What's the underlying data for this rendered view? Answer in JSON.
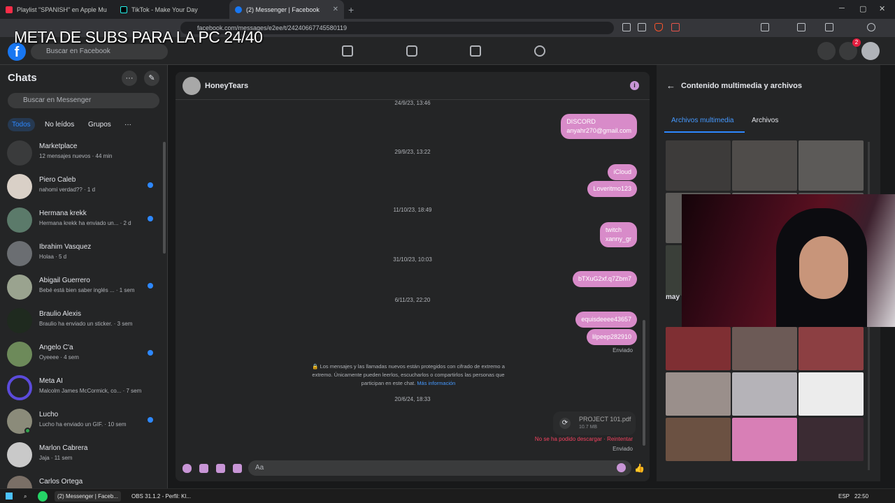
{
  "overlay_title": "META DE SUBS PARA LA PC 24/40",
  "browser": {
    "tabs": [
      {
        "label": "Playlist \"SPANISH\" en Apple Mu",
        "color": "#fa2d48"
      },
      {
        "label": "TikTok - Make Your Day",
        "color": "#111111"
      },
      {
        "label": "(2) Messenger | Facebook",
        "color": "#1877f2"
      }
    ],
    "new_tab": "+",
    "url": "facebook.com/messages/e2ee/t/24240667745580119"
  },
  "fb": {
    "search_placeholder": "Buscar en Facebook",
    "notification_count": "2"
  },
  "sidebar": {
    "title": "Chats",
    "search_placeholder": "Buscar en Messenger",
    "filters": [
      "Todos",
      "No leídos",
      "Grupos",
      "···"
    ],
    "chats": [
      {
        "name": "Marketplace",
        "preview": "12 mensajes nuevos · 44 min",
        "color": "#3a3b3c",
        "unread": false
      },
      {
        "name": "Piero Caleb",
        "preview": "nahomi verdad?? · 1 d",
        "color": "#d9d0c7",
        "unread": true
      },
      {
        "name": "Hermana krekk",
        "preview": "Hermana krekk ha enviado un... · 2 d",
        "color": "#5b7a6a",
        "unread": true
      },
      {
        "name": "Ibrahim Vasquez",
        "preview": "Holaa · 5 d",
        "color": "#6b6e72",
        "unread": false
      },
      {
        "name": "Abigail Guerrero",
        "preview": "Bebé está bien saber inglés ... · 1 sem",
        "color": "#9aa38f",
        "unread": true
      },
      {
        "name": "Braulio Alexis",
        "preview": "Braulio ha enviado un sticker. · 3 sem",
        "color": "#1f2a1f",
        "unread": false
      },
      {
        "name": "Angelo C'a",
        "preview": "Oyeeee · 4 sem",
        "color": "#6d8a5a",
        "unread": true
      },
      {
        "name": "Meta AI",
        "preview": "Malcolm James McCormick, co... · 7 sem",
        "color": "#5b4bdb",
        "unread": false
      },
      {
        "name": "Lucho",
        "preview": "Lucho ha enviado un GIF. · 10 sem",
        "color": "#8b8b7a",
        "unread": true
      },
      {
        "name": "Marlon Cabrera",
        "preview": "Jaja · 11 sem",
        "color": "#c9c9c9",
        "unread": false
      },
      {
        "name": "Carlos Ortega",
        "preview": "",
        "color": "#7a6f66",
        "unread": false
      }
    ]
  },
  "conversation": {
    "contact": "HoneyTears",
    "info_glyph": "i",
    "messages": {
      "ts0": "24/9/23, 13:46",
      "b1a": "DISCORD",
      "b1b": "anyahr270@gmail.com",
      "ts1": "29/9/23, 13:22",
      "b2": "iCloud",
      "b3": "Loveritmo123",
      "ts2": "11/10/23, 18:49",
      "b4a": "twitch",
      "b4b": "xanny_gr",
      "ts3": "31/10/23, 10:03",
      "b5": "bTXuG2xf.q7Zbm7",
      "ts4": "6/11/23, 22:20",
      "b6": "equisdeeee43657",
      "b7": "lilpeep282910",
      "sent1": "Enviado",
      "e2e_text": "🔒 Los mensajes y las llamadas nuevos están protegidos con cifrado de extremo a extremo. Únicamente pueden leerlos, escucharlos o compartirlos las personas que participan en este chat.",
      "e2e_link": "Más información",
      "ts5": "20/6/24, 18:33",
      "file_name": "PROJECT 101.pdf",
      "file_size": "10.7 MB",
      "file_error": "No se ha podido descargar · Reintentar",
      "sent2": "Enviado"
    },
    "composer_placeholder": "Aa"
  },
  "media_panel": {
    "title": "Contenido multimedia y archivos",
    "tabs": [
      "Archivos multimedia",
      "Archivos"
    ],
    "month_label": "may",
    "thumbs_top": [
      "#3d3b3a",
      "#4f4c4a",
      "#5c5a58",
      "#5d5b59",
      "#6b6a69",
      "#595858",
      "#3a3f39",
      "#565a5d"
    ],
    "thumbs_bottom": [
      "#7f2f33",
      "#6c5a56",
      "#8c3f42",
      "#9a8f8b",
      "#b5b3b8",
      "#ececec",
      "#6b5142",
      "#d87fb6",
      "#3b2b33"
    ]
  },
  "taskbar": {
    "items": [
      "(2) Messenger | Faceb...",
      "OBS 31.1.2 - Perfil: Kl..."
    ],
    "lang": "ESP",
    "time": "22:50"
  }
}
